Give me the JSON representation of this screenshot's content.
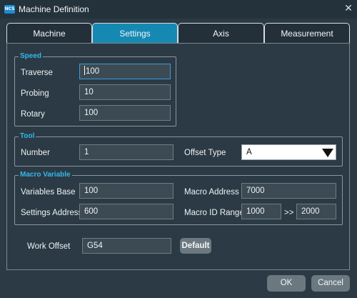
{
  "window": {
    "title": "Machine Definition",
    "app_icon_text": "NCS",
    "close_glyph": "✕"
  },
  "tabs": [
    {
      "label": "Machine",
      "active": false
    },
    {
      "label": "Settings",
      "active": true
    },
    {
      "label": "Axis",
      "active": false
    },
    {
      "label": "Measurement",
      "active": false
    }
  ],
  "speed": {
    "legend": "Speed",
    "traverse_label": "Traverse",
    "traverse_value": "100",
    "probing_label": "Probing",
    "probing_value": "10",
    "rotary_label": "Rotary",
    "rotary_value": "100"
  },
  "tool": {
    "legend": "Tool",
    "number_label": "Number",
    "number_value": "1",
    "offset_type_label": "Offset Type",
    "offset_type_value": "A"
  },
  "macro": {
    "legend": "Macro Variable",
    "variables_base_label": "Variables Base",
    "variables_base_value": "100",
    "macro_address_label": "Macro Address",
    "macro_address_value": "7000",
    "settings_address_label": "Settings Address",
    "settings_address_value": "600",
    "macro_id_range_label": "Macro ID Range",
    "macro_id_from": "1000",
    "range_separator": ">>",
    "macro_id_to": "2000"
  },
  "work_offset": {
    "label": "Work Offset",
    "value": "G54",
    "default_button": "Default"
  },
  "footer": {
    "ok_label": "OK",
    "cancel_label": "Cancel"
  },
  "colors": {
    "accent": "#1689b3",
    "legend": "#35b8ec",
    "background": "#2b3a44"
  }
}
